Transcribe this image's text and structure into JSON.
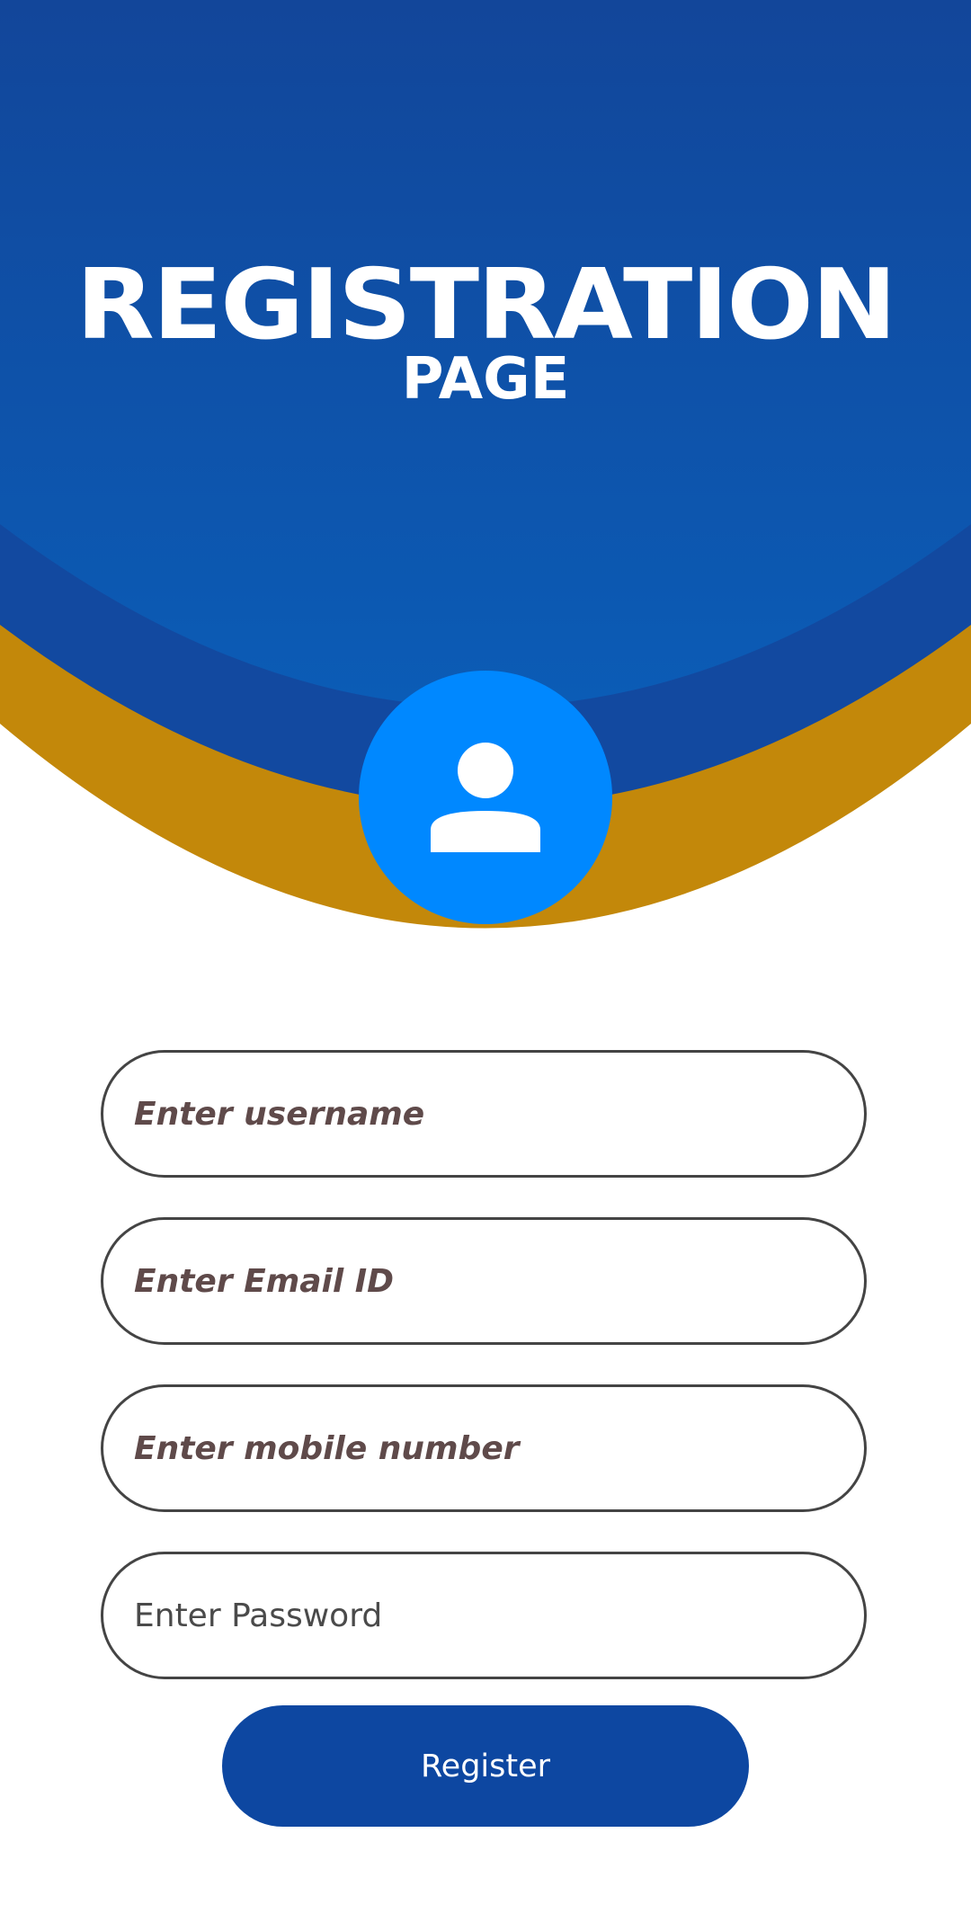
{
  "header": {
    "title": "REGISTRATION",
    "subtitle": "PAGE"
  },
  "avatar": {
    "icon": "person-icon"
  },
  "form": {
    "username_placeholder": "Enter username",
    "email_placeholder": "Enter Email ID",
    "mobile_placeholder": "Enter mobile number",
    "password_placeholder": "Enter Password",
    "register_label": "Register"
  },
  "colors": {
    "header_blue_top": "#12469a",
    "header_blue_bottom": "#0b5cb6",
    "band_blue": "#1249a0",
    "band_gold": "#c3880a",
    "avatar_blue": "#0088ff",
    "button_blue": "#0d47a1"
  }
}
